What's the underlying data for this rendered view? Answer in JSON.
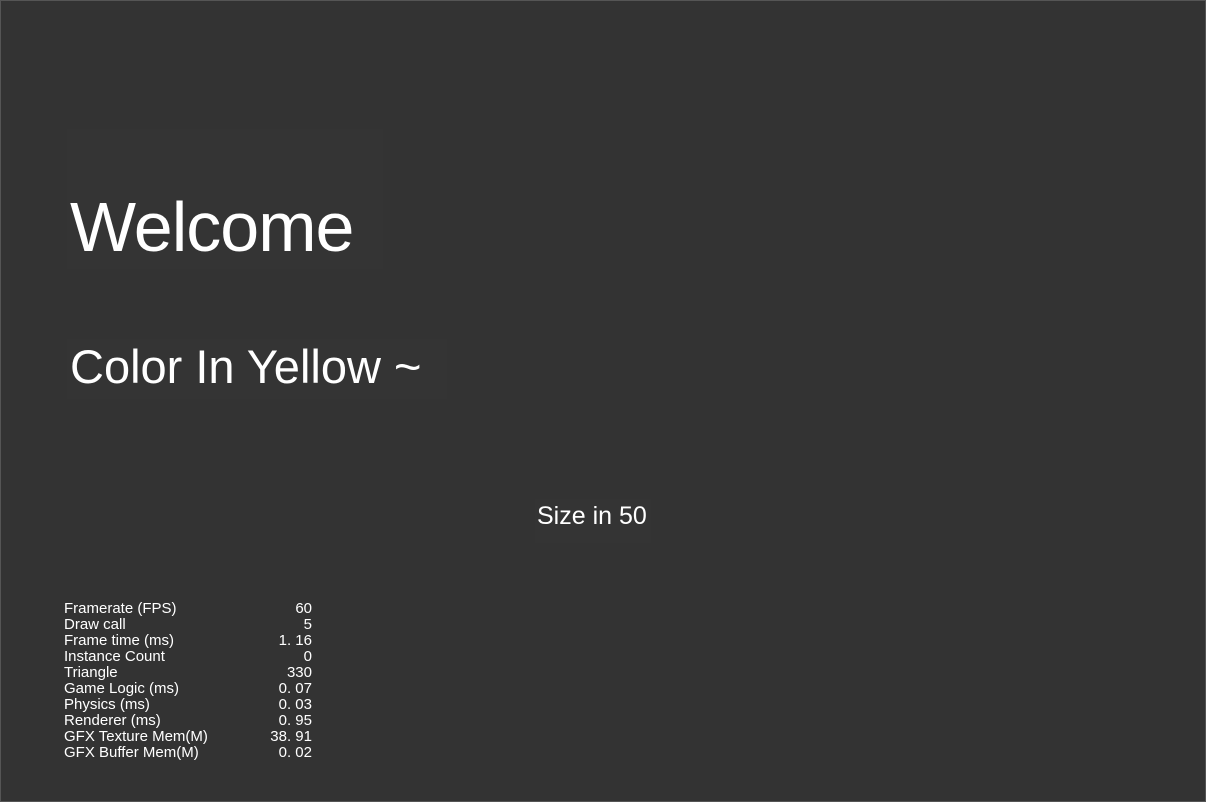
{
  "scene": {
    "welcome_text": "Welcome",
    "color_text": "Color In Yellow ~",
    "size_text": "Size in 50"
  },
  "stats": [
    {
      "name": "Framerate (FPS)",
      "value": "60"
    },
    {
      "name": "Draw call",
      "value": "5"
    },
    {
      "name": "Frame time (ms)",
      "value": "1. 16"
    },
    {
      "name": "Instance Count",
      "value": "0"
    },
    {
      "name": "Triangle",
      "value": "330"
    },
    {
      "name": "Game Logic (ms)",
      "value": "0. 07"
    },
    {
      "name": "Physics (ms)",
      "value": "0. 03"
    },
    {
      "name": "Renderer (ms)",
      "value": "0. 95"
    },
    {
      "name": "GFX Texture Mem(M)",
      "value": "38. 91"
    },
    {
      "name": "GFX Buffer Mem(M)",
      "value": "0. 02"
    }
  ],
  "colors": {
    "background": "#333333",
    "text": "#ffffff"
  }
}
